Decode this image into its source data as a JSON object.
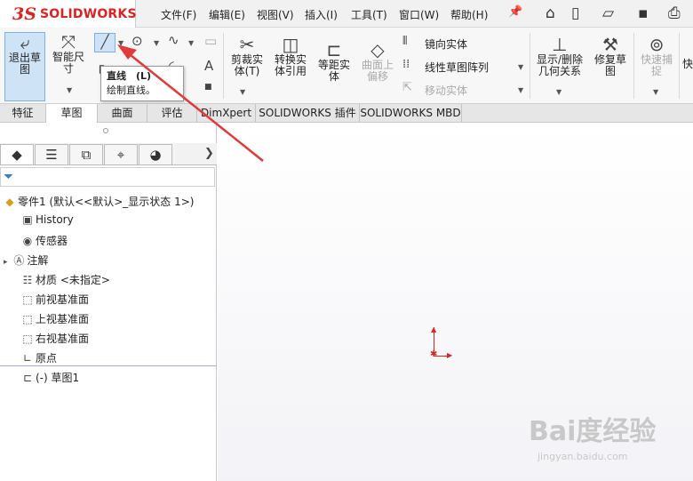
{
  "app": {
    "logo_mark": "3S",
    "logo_text": "SOLIDWORKS"
  },
  "menu": [
    "文件(F)",
    "编辑(E)",
    "视图(V)",
    "插入(I)",
    "工具(T)",
    "窗口(W)",
    "帮助(H)"
  ],
  "quick_icons": [
    "home-icon",
    "new-document-icon",
    "open-folder-icon",
    "save-icon",
    "print-icon"
  ],
  "commands": {
    "exit_sketch": "退出草图",
    "smart_dim": "智能尺寸",
    "trim": "剪裁实体(T)",
    "convert": "转换实体引用",
    "offset": "等距实体",
    "surface_offset": "曲面上偏移",
    "mirror": "镜向实体",
    "linear_pattern": "线性草图阵列",
    "move": "移动实体",
    "show_relations": "显示/删除几何关系",
    "repair": "修复草图",
    "quick_snap": "快速捕捉",
    "quick": "快"
  },
  "tooltip": {
    "title": "直线　(L)",
    "desc": "绘制直线。"
  },
  "tabs": [
    "特征",
    "草图",
    "曲面",
    "评估",
    "DimXpert",
    "SOLIDWORKS 插件",
    "SOLIDWORKS MBD"
  ],
  "tree": {
    "root": "零件1 (默认<<默认>_显示状态 1>)",
    "items": [
      "History",
      "传感器",
      "注解",
      "材质 <未指定>",
      "前视基准面",
      "上视基准面",
      "右视基准面",
      "原点",
      "(-) 草图1"
    ]
  },
  "watermark": {
    "main": "Bai度经验",
    "sub": "jingyan.baidu.com"
  },
  "colors": {
    "accent": "#d22222",
    "selected": "#cfe3f7"
  }
}
